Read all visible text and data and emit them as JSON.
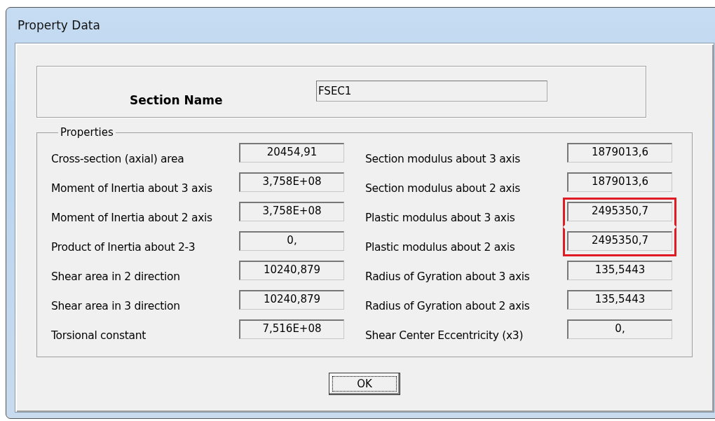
{
  "window": {
    "title": "Property Data"
  },
  "section": {
    "label": "Section Name",
    "value": "FSEC1"
  },
  "properties": {
    "title": "Properties",
    "left": [
      {
        "label": "Cross-section (axial) area",
        "value": "20454,91",
        "highlighted": false
      },
      {
        "label": "Moment of Inertia about 3 axis",
        "value": "3,758E+08",
        "highlighted": false
      },
      {
        "label": "Moment of Inertia about 2 axis",
        "value": "3,758E+08",
        "highlighted": false
      },
      {
        "label": "Product of Inertia about 2-3",
        "value": "0,",
        "highlighted": false
      },
      {
        "label": "Shear area in 2 direction",
        "value": "10240,879",
        "highlighted": false
      },
      {
        "label": "Shear area in 3 direction",
        "value": "10240,879",
        "highlighted": false
      },
      {
        "label": "Torsional constant",
        "value": "7,516E+08",
        "highlighted": false
      }
    ],
    "right": [
      {
        "label": "Section modulus about 3 axis",
        "value": "1879013,6",
        "highlighted": false
      },
      {
        "label": "Section modulus about 2 axis",
        "value": "1879013,6",
        "highlighted": false
      },
      {
        "label": "Plastic modulus about 3 axis",
        "value": "2495350,7",
        "highlighted": true
      },
      {
        "label": "Plastic modulus about 2 axis",
        "value": "2495350,7",
        "highlighted": true
      },
      {
        "label": "Radius of Gyration about 3 axis",
        "value": "135,5443",
        "highlighted": false
      },
      {
        "label": "Radius of Gyration about 2 axis",
        "value": "135,5443",
        "highlighted": false
      },
      {
        "label": "Shear Center Eccentricity (x3)",
        "value": "0,",
        "highlighted": false
      }
    ]
  },
  "buttons": [
    {
      "label": "OK",
      "focused": true
    }
  ]
}
